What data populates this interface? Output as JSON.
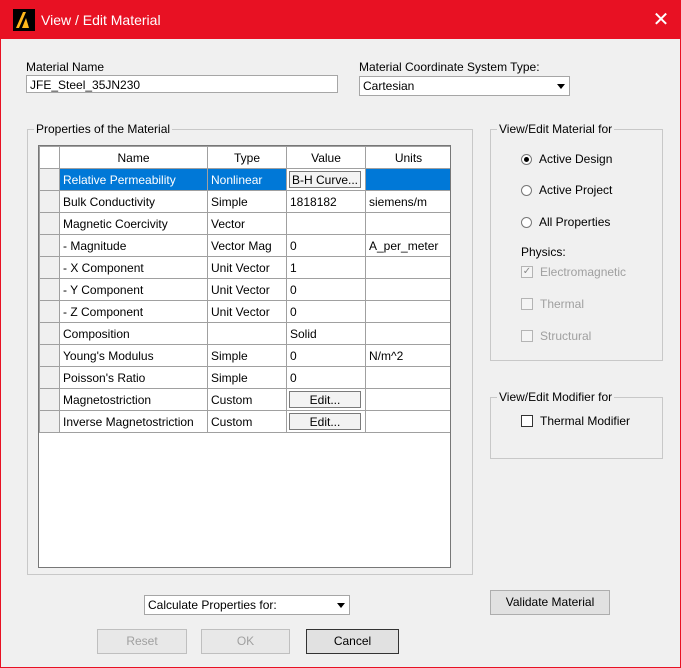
{
  "window": {
    "title": "View / Edit Material",
    "close_symbol": "✕",
    "accent_color": "#e81123"
  },
  "material_name": {
    "label": "Material Name",
    "value": "JFE_Steel_35JN230"
  },
  "coord_system": {
    "label": "Material Coordinate System Type:",
    "value": "Cartesian"
  },
  "properties": {
    "group_label": "Properties of the Material",
    "columns": [
      "Name",
      "Type",
      "Value",
      "Units"
    ],
    "rows": [
      {
        "name": "Relative Permeability",
        "type": "Nonlinear",
        "value": "B-H Curve...",
        "units": "",
        "value_is_button": true
      },
      {
        "name": "Bulk Conductivity",
        "type": "Simple",
        "value": "1818182",
        "units": "siemens/m",
        "value_is_button": false
      },
      {
        "name": "Magnetic Coercivity",
        "type": "Vector",
        "value": "",
        "units": "",
        "value_is_button": false
      },
      {
        "name": "- Magnitude",
        "type": "Vector Mag",
        "value": "0",
        "units": "A_per_meter",
        "value_is_button": false
      },
      {
        "name": "- X Component",
        "type": "Unit Vector",
        "value": "1",
        "units": "",
        "value_is_button": false
      },
      {
        "name": "- Y Component",
        "type": "Unit Vector",
        "value": "0",
        "units": "",
        "value_is_button": false
      },
      {
        "name": "- Z Component",
        "type": "Unit Vector",
        "value": "0",
        "units": "",
        "value_is_button": false
      },
      {
        "name": "Composition",
        "type": "",
        "value": "Solid",
        "units": "",
        "value_is_button": false
      },
      {
        "name": "Young's Modulus",
        "type": "Simple",
        "value": "0",
        "units": "N/m^2",
        "value_is_button": false
      },
      {
        "name": "Poisson's Ratio",
        "type": "Simple",
        "value": "0",
        "units": "",
        "value_is_button": false
      },
      {
        "name": "Magnetostriction",
        "type": "Custom",
        "value": "Edit...",
        "units": "",
        "value_is_button": true
      },
      {
        "name": "Inverse Magnetostriction",
        "type": "Custom",
        "value": "Edit...",
        "units": "",
        "value_is_button": true
      }
    ],
    "selected_row": 0
  },
  "view_edit_for": {
    "group_label": "View/Edit Material for",
    "options": [
      "Active Design",
      "Active Project",
      "All Properties"
    ],
    "selected": 0,
    "physics_label": "Physics:",
    "physics": [
      {
        "label": "Electromagnetic",
        "checked": true
      },
      {
        "label": "Thermal",
        "checked": false
      },
      {
        "label": "Structural",
        "checked": false
      }
    ]
  },
  "modifier": {
    "group_label": "View/Edit Modifier for",
    "thermal_label": "Thermal Modifier",
    "thermal_checked": false
  },
  "calculate": {
    "value": "Calculate Properties for:"
  },
  "buttons": {
    "validate": "Validate Material",
    "reset": "Reset",
    "ok": "OK",
    "cancel": "Cancel"
  }
}
